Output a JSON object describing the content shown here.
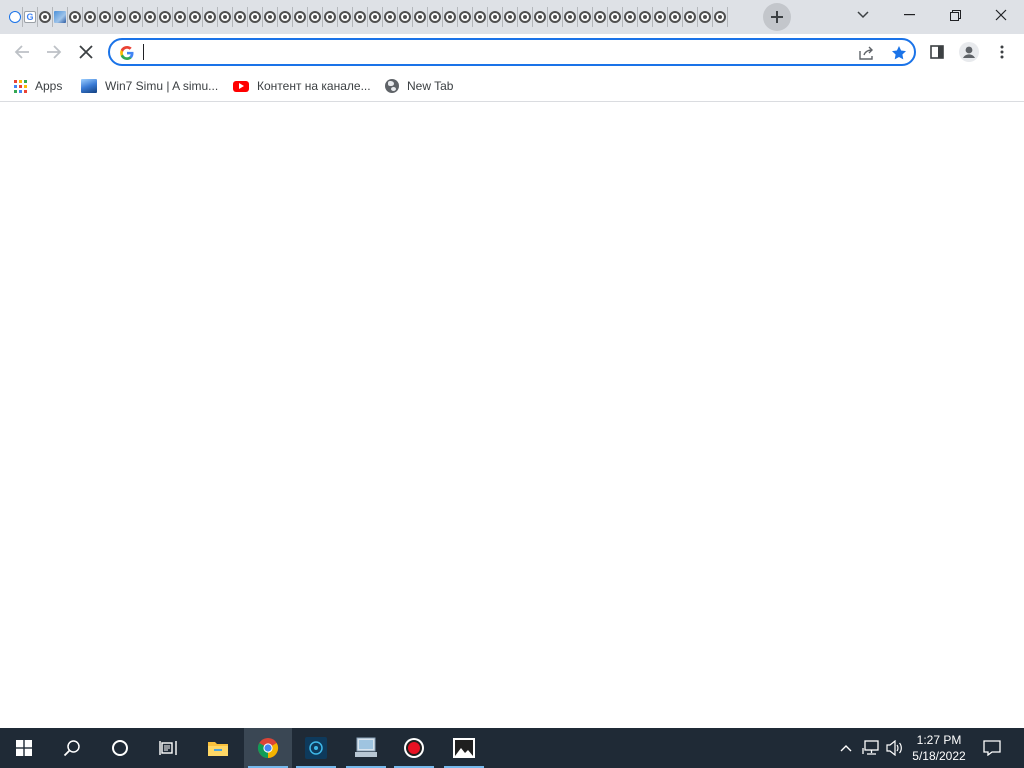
{
  "browser": {
    "tab_count_visible": 48,
    "tab_favicons": [
      "clock-icon",
      "google-icon",
      "chrome-icon",
      "image-icon",
      "chrome-icon",
      "chrome-icon",
      "chrome-icon",
      "chrome-icon",
      "chrome-icon",
      "chrome-icon",
      "chrome-icon",
      "chrome-icon",
      "chrome-icon",
      "chrome-icon",
      "chrome-icon",
      "chrome-icon",
      "chrome-icon",
      "chrome-icon",
      "chrome-icon",
      "chrome-icon",
      "chrome-icon",
      "chrome-icon",
      "chrome-icon",
      "chrome-icon",
      "chrome-icon",
      "chrome-icon",
      "chrome-icon",
      "chrome-icon",
      "chrome-icon",
      "chrome-icon",
      "chrome-icon",
      "chrome-icon",
      "chrome-icon",
      "chrome-icon",
      "chrome-icon",
      "chrome-icon",
      "chrome-icon",
      "chrome-icon",
      "chrome-icon",
      "chrome-icon",
      "chrome-icon",
      "chrome-icon",
      "chrome-icon",
      "chrome-icon",
      "chrome-icon",
      "chrome-icon",
      "chrome-icon",
      "chrome-icon"
    ],
    "address_bar": {
      "value": "",
      "placeholder": ""
    },
    "accent_color": "#1a73e8",
    "bookmarks": [
      {
        "label": "Apps",
        "icon": "apps-grid-icon"
      },
      {
        "label": "Win7 Simu | A simu...",
        "icon": "win7-simu-icon"
      },
      {
        "label": "Контент на канале...",
        "icon": "youtube-icon"
      },
      {
        "label": "New Tab",
        "icon": "globe-icon"
      }
    ]
  },
  "taskbar": {
    "apps": [
      "start-icon",
      "search-icon",
      "cortana-icon",
      "task-view-icon",
      "file-explorer-icon",
      "chrome-icon",
      "app-icon",
      "network-app-icon",
      "record-icon",
      "photos-icon"
    ],
    "time": "1:27 PM",
    "date": "5/18/2022",
    "background": "#1f2a36"
  }
}
